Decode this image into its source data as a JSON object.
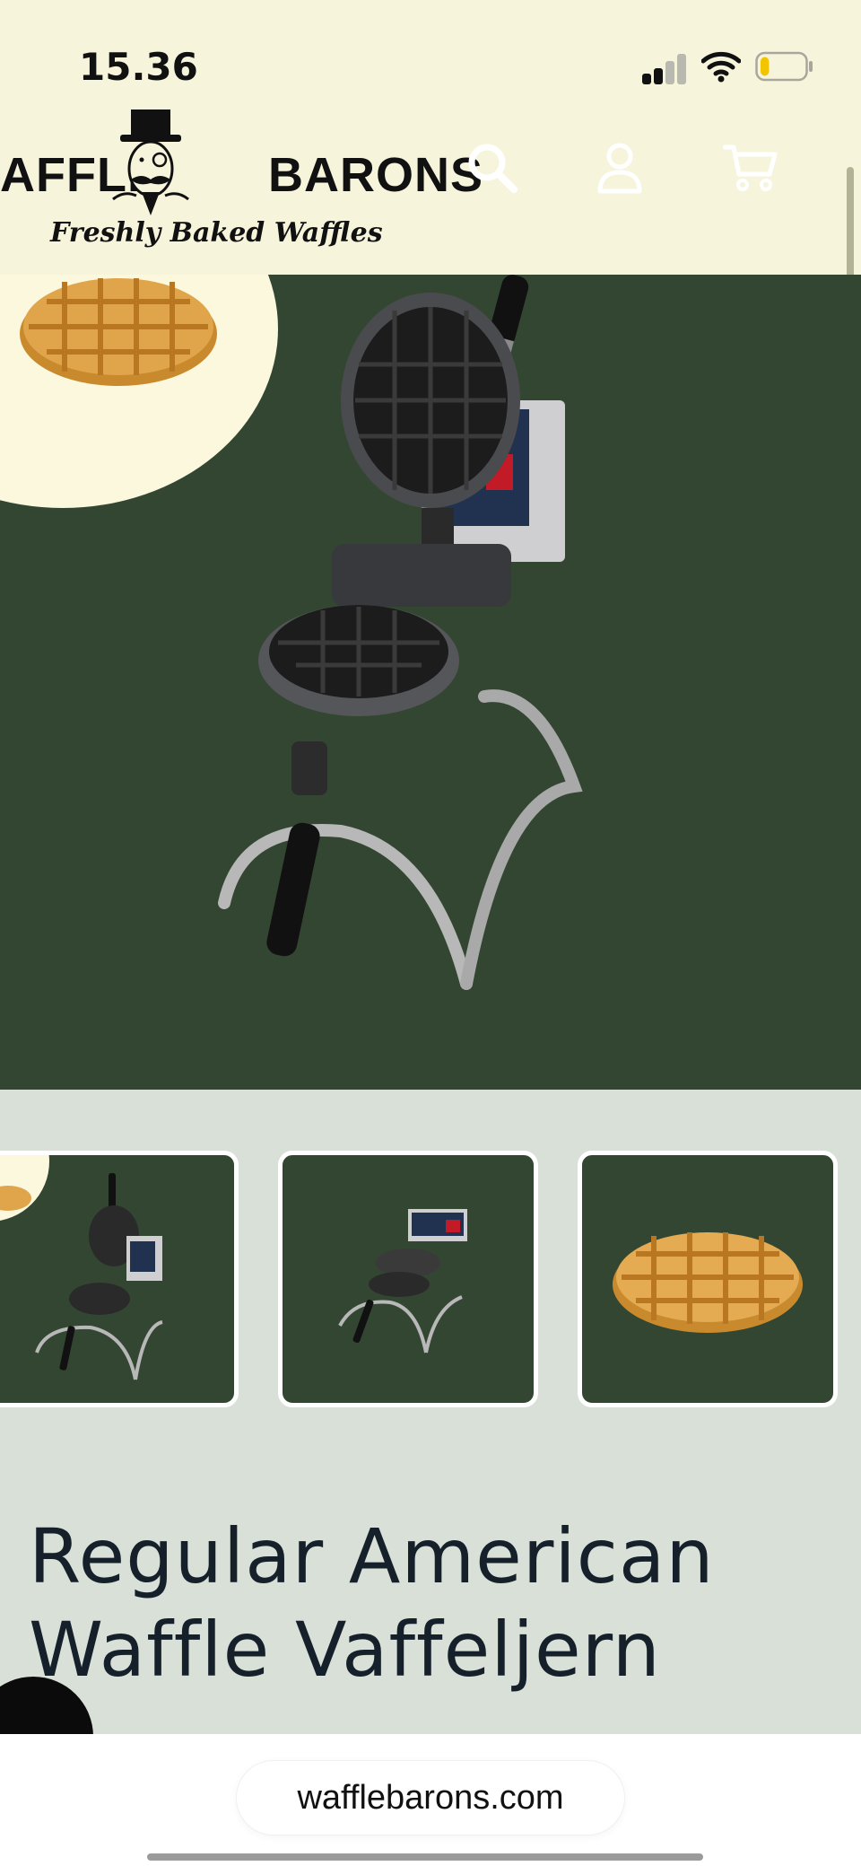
{
  "status_bar": {
    "time": "15.36",
    "battery_level": 0.2,
    "battery_color": "#f2c500",
    "signal_bars_active": 2
  },
  "brand": {
    "name_left": "AFFLE",
    "name_right": "BARONS",
    "tagline": "Freshly Baked Waffles"
  },
  "header_icons": [
    "search-icon",
    "account-icon",
    "cart-icon"
  ],
  "gallery": {
    "main_image": "waffle-maker-open",
    "thumbnails": [
      "waffle-maker-open",
      "waffle-maker-rotated",
      "waffle"
    ]
  },
  "product": {
    "title": "Regular American Waffle Vaffeljern"
  },
  "browser": {
    "url": "wafflebarons.com"
  },
  "colors": {
    "cream": "#f7f4dc",
    "hero_green": "#334632",
    "thumb_bg": "#d9e0d8",
    "title_text": "#15202b"
  }
}
